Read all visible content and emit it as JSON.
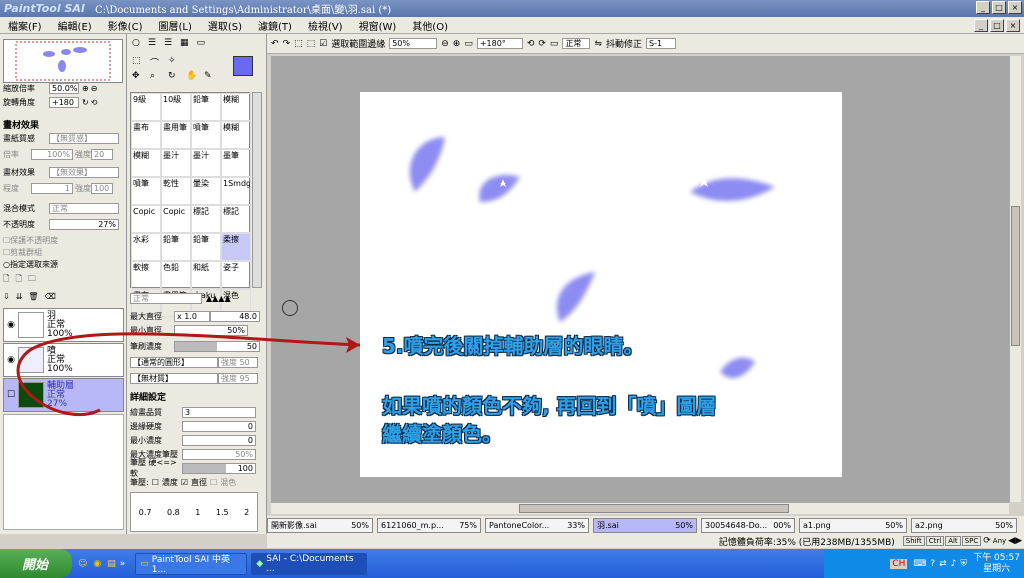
{
  "window": {
    "logo": "PaintTool SAI",
    "title": "C:\\Documents and Settings\\Administrator\\桌面\\變\\羽.sai (*)"
  },
  "menu": [
    "檔案(F)",
    "編輯(E)",
    "影像(C)",
    "圖層(L)",
    "選取(S)",
    "濾鏡(T)",
    "檢視(V)",
    "視窗(W)",
    "其他(O)"
  ],
  "nav": {
    "zoom_label": "縮放倍率",
    "zoom_value": "50.0%",
    "rotate_label": "旋轉角度",
    "rotate_value": "+180"
  },
  "paper_effects": {
    "title": "畫材效果",
    "texture_label": "畫紙質感",
    "texture_value": "【無質感】",
    "scale_label": "倍率",
    "scale_value": "100%",
    "strength_label": "強度",
    "strength_value": "20",
    "effect_label": "畫材效果",
    "effect_value": "【無效果】",
    "degree_label": "程度",
    "degree_value": "1",
    "strength2_label": "強度",
    "strength2_value": "100"
  },
  "blend": {
    "mode_label": "混合模式",
    "mode_value": "正常",
    "opacity_label": "不透明度",
    "opacity_value": "27%"
  },
  "checks": {
    "preserve_opacity": "保護不透明度",
    "clip": "剪裁群組",
    "selection_source": "指定選取來源"
  },
  "layers": [
    {
      "name": "羽",
      "mode": "正常",
      "opacity": "100%"
    },
    {
      "name": "噴",
      "mode": "正常",
      "opacity": "100%"
    },
    {
      "name": "輔助層",
      "mode": "正常",
      "opacity": "27%"
    }
  ],
  "brushes": [
    [
      "9級",
      "10級",
      "鉛筆",
      "模糊"
    ],
    [
      "畫布",
      "畫用筆",
      "噴筆",
      "模糊"
    ],
    [
      "模糊",
      "墨汁",
      "墨汁",
      "墨筆"
    ],
    [
      "噴筆",
      "乾性",
      "暈染",
      "1Smdg"
    ],
    [
      "Copic",
      "Copic",
      "標記",
      "標記"
    ],
    [
      "水彩",
      "鉛筆",
      "鉛筆",
      "柔擦"
    ],
    [
      "軟擦",
      "色鉛",
      "和紙",
      "姿子"
    ],
    [
      "畫布",
      "畫用筆",
      "水aku",
      "混色"
    ]
  ],
  "brush_settings": {
    "mode": "正常",
    "max_size_label": "最大直徑",
    "max_size_mult": "x 1.0",
    "max_size_value": "48.0",
    "min_size_label": "最小直徑",
    "min_size_value": "50%",
    "density_label": "筆刷濃度",
    "density_value": "50",
    "shape_value": "【通常的圓形】",
    "shape_strength": "強度 50",
    "texture_value": "【無材質】",
    "texture_strength": "強度 95",
    "detail_title": "詳細設定",
    "quality_label": "繪畫品質",
    "quality_value": "3",
    "edge_label": "邊緣硬度",
    "edge_value": "0",
    "min_density_label": "最小濃度",
    "min_density_value": "0",
    "max_dense_label": "最大濃度筆壓",
    "max_dense_value": "50%",
    "pressure_label": "筆壓 硬<=>軟",
    "pressure_value": "100",
    "pressure2_label": "筆壓:",
    "press_density": "濃度",
    "press_size": "直徑",
    "press_blend": "混色",
    "sizes": [
      "0.7",
      "0.8",
      "1",
      "1.5",
      "2"
    ]
  },
  "toolbar": {
    "select_edge": "選取範圍邊緣",
    "zoom": "50%",
    "angle": "+180°",
    "normal": "正常",
    "stabilizer_label": "抖動修正",
    "stabilizer": "S-1"
  },
  "annotation": {
    "line1": "5.噴完後關掉輔助層的眼睛。",
    "line2": "如果噴的顏色不夠, 再回到「噴」圖層",
    "line3": "繼續塗顏色。"
  },
  "tabs": [
    {
      "name": "開新影像.sai",
      "zoom": "50%"
    },
    {
      "name": "6121060_m.p...",
      "zoom": "75%"
    },
    {
      "name": "PantoneColor...",
      "zoom": "33%"
    },
    {
      "name": "羽.sai",
      "zoom": "50%"
    },
    {
      "name": "30054648-Do...",
      "zoom": "00%"
    },
    {
      "name": "a1.png",
      "zoom": "50%"
    },
    {
      "name": "a2.png",
      "zoom": "50%"
    }
  ],
  "status": {
    "memory": "記憶體負荷率:35% (已用238MB/1355MB)",
    "keys": [
      "Shift",
      "Ctrl",
      "Alt",
      "SPC"
    ],
    "any": "Any"
  },
  "taskbar": {
    "start": "開始",
    "items": [
      "PaintTool SAI 中英1...",
      "SAI - C:\\Documents ..."
    ],
    "time": "下午 05:57",
    "day": "星期六",
    "lang": "CH"
  }
}
